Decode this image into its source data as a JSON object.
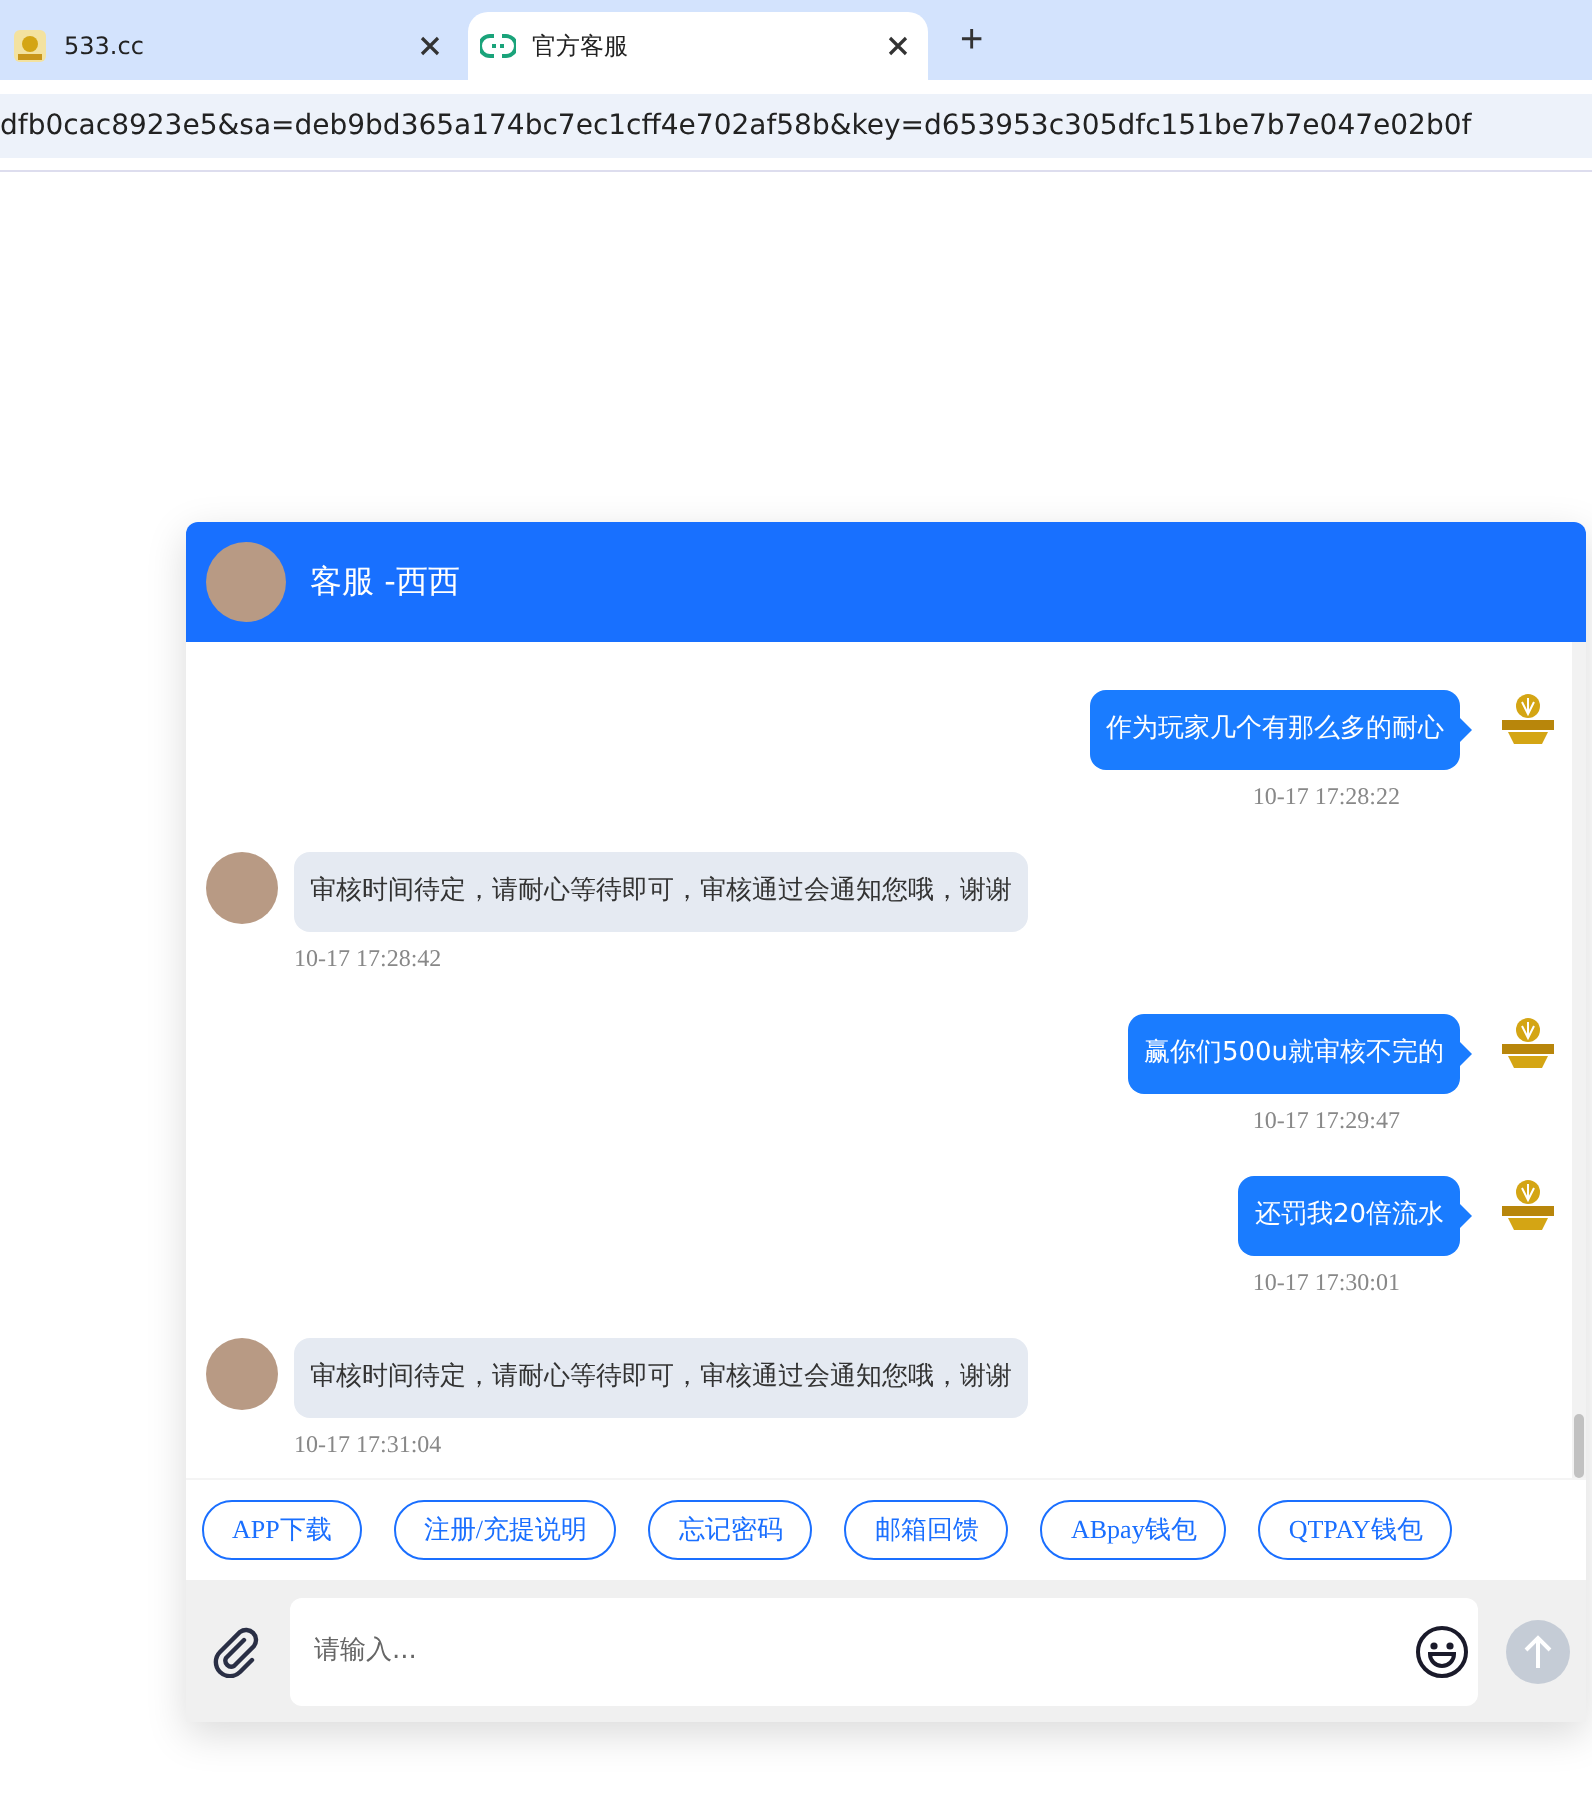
{
  "browser": {
    "tabs": [
      {
        "title": "533.cc",
        "selected": false
      },
      {
        "title": "官方客服",
        "selected": true
      }
    ],
    "new_tab": "+",
    "url": "dfb0cac8923e5&sa=deb9bd365a174bc7ec1cff4e702af58b&key=d653953c305dfc151be7b7e047e02b0f"
  },
  "chat": {
    "title": "客服 -西西",
    "messages": [
      {
        "kind": "sent",
        "text": "作为玩家几个有那么多的耐心",
        "time": "10-17 17:28:22"
      },
      {
        "kind": "received",
        "text": "审核时间待定，请耐心等待即可，审核通过会通知您哦，谢谢",
        "time": "10-17 17:28:42"
      },
      {
        "kind": "sent",
        "text": "赢你们500u就审核不完的",
        "time": "10-17 17:29:47"
      },
      {
        "kind": "sent",
        "text": "还罚我20倍流水",
        "time": "10-17 17:30:01"
      },
      {
        "kind": "received",
        "text": "审核时间待定，请耐心等待即可，审核通过会通知您哦，谢谢",
        "time": "10-17 17:31:04"
      }
    ],
    "quick_replies": [
      "APP下载",
      "注册/充提说明",
      "忘记密码",
      "邮箱回馈",
      "ABpay钱包",
      "QTPAY钱包"
    ],
    "input": {
      "placeholder": "请输入..."
    }
  }
}
